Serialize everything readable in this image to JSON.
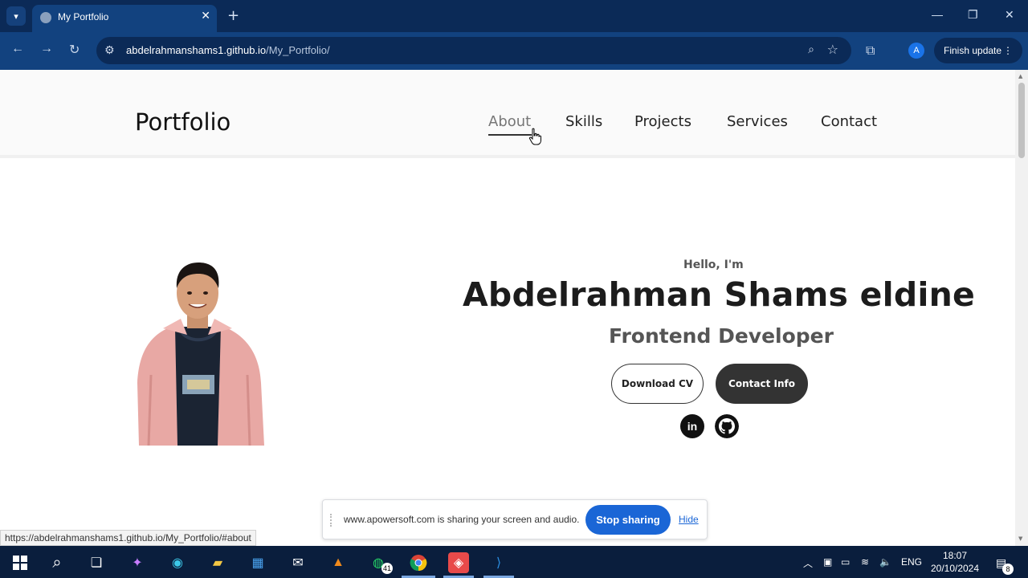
{
  "browser": {
    "tab_title": "My Portfolio",
    "new_tab": "+",
    "url_host": "abdelrahmanshams1.github.io",
    "url_path": "/My_Portfolio/",
    "finish_update": "Finish update",
    "profile_initial": "A",
    "status_url": "https://abdelrahmanshams1.github.io/My_Portfolio/#about"
  },
  "site": {
    "logo": "Portfolio",
    "nav": [
      "About",
      "Skills",
      "Projects",
      "Services",
      "Contact"
    ],
    "hero": {
      "greeting": "Hello, I'm",
      "name": "Abdelrahman Shams eldine",
      "role": "Frontend Developer",
      "download_cv": "Download CV",
      "contact_info": "Contact Info",
      "linkedin": "in"
    }
  },
  "sharing": {
    "message": "www.apowersoft.com is sharing your screen and audio.",
    "stop": "Stop sharing",
    "hide": "Hide"
  },
  "taskbar": {
    "whatsapp_badge": "41",
    "language": "ENG",
    "time": "18:07",
    "date": "20/10/2024",
    "notifications": "8"
  },
  "colors": {
    "browser_dark": "#0b2a57",
    "browser_mid": "#12427f",
    "accent_blue": "#1a66d6",
    "button_dark": "#333333"
  }
}
